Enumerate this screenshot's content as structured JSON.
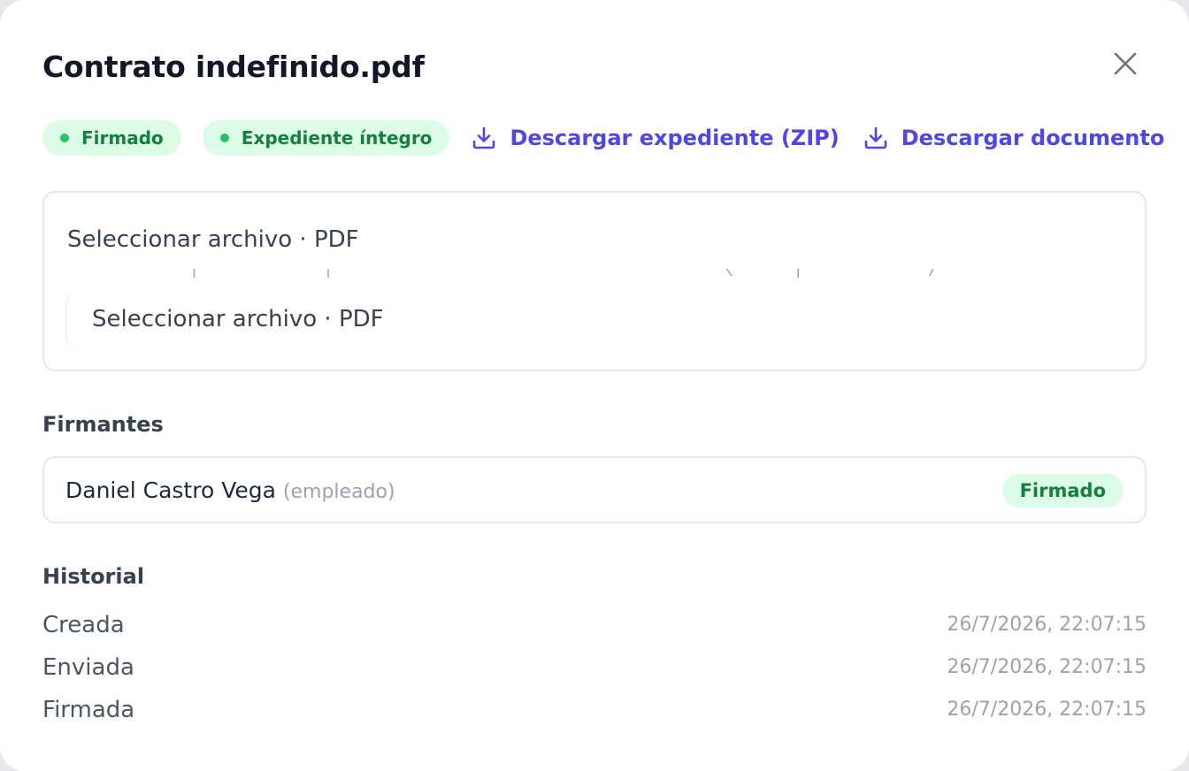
{
  "modal": {
    "title": "Contrato indefinido.pdf",
    "close_icon": "close-icon"
  },
  "badges": [
    {
      "label": "Firmado",
      "color": "#15803d",
      "dot_color": "#22c55e",
      "bg": "#dcfce7"
    },
    {
      "label": "Expediente íntegro",
      "color": "#15803d",
      "dot_color": "#22c55e",
      "bg": "#dcfce7"
    }
  ],
  "downloads": [
    {
      "label": "Descargar expediente (ZIP)",
      "icon": "download-icon"
    },
    {
      "label": "Descargar documento",
      "icon": "download-icon"
    }
  ],
  "preview": {
    "file_input_1": "Seleccionar archivo · PDF",
    "file_input_2": "Seleccionar archivo · PDF"
  },
  "signers": {
    "title": "Firmantes",
    "items": [
      {
        "name": "Daniel Castro Vega",
        "role": "(empleado)",
        "status": "Firmado"
      }
    ]
  },
  "history": {
    "title": "Historial",
    "items": [
      {
        "label": "Creada",
        "time": "26/7/2026, 22:07:15"
      },
      {
        "label": "Enviada",
        "time": "26/7/2026, 22:07:15"
      },
      {
        "label": "Firmada",
        "time": "26/7/2026, 22:07:15"
      }
    ]
  },
  "colors": {
    "accent": "#4f46e5",
    "success_text": "#15803d",
    "success_bg": "#dcfce7",
    "border": "#e5e7eb",
    "muted": "#9ca3af"
  }
}
